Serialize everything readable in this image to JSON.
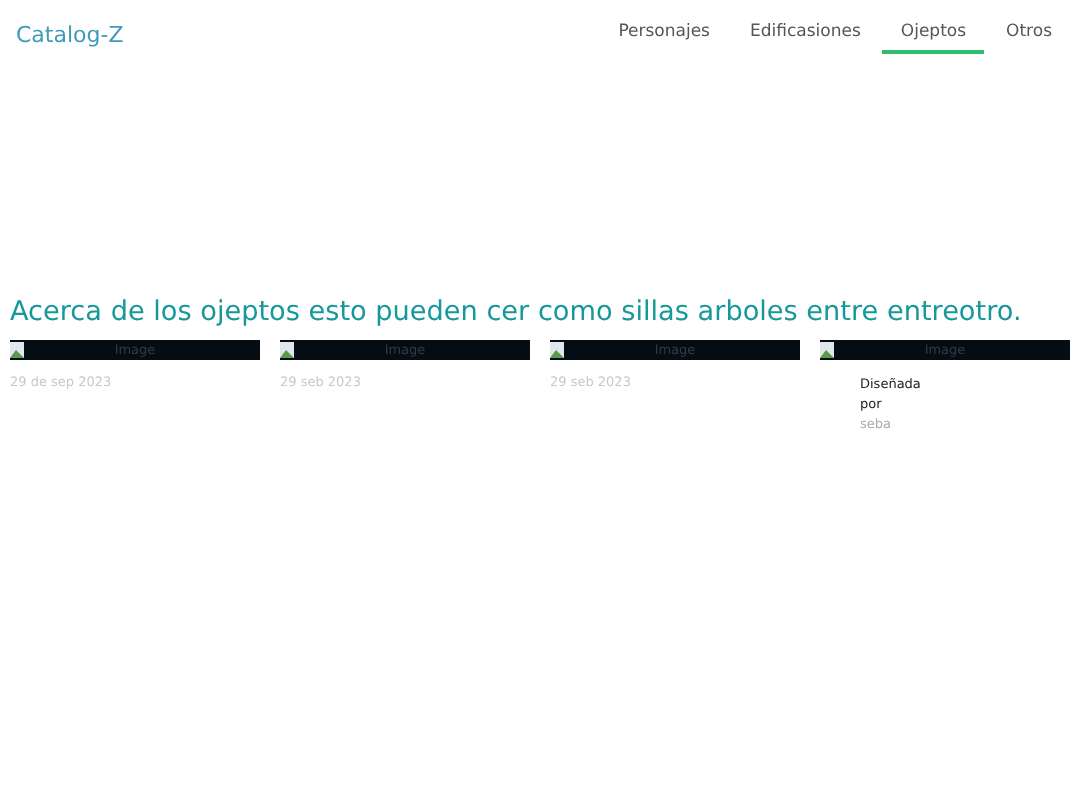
{
  "brand": "Catalog-Z",
  "nav": [
    {
      "label": "Personajes",
      "selected": false
    },
    {
      "label": "Edificasiones",
      "selected": false
    },
    {
      "label": "Ojeptos",
      "selected": true
    },
    {
      "label": "Otros",
      "selected": false
    }
  ],
  "heading": "Acerca de los ojeptos esto pueden cer como sillas arboles entre entreotro.",
  "cards": [
    {
      "image_alt": "Image",
      "kind": "date",
      "date": "29 de sep 2023"
    },
    {
      "image_alt": "Image",
      "kind": "date",
      "date": "29 seb 2023"
    },
    {
      "image_alt": "Image",
      "kind": "date",
      "date": "29 seb 2023"
    },
    {
      "image_alt": "Image",
      "kind": "credit",
      "credit_label": "Diseñada por",
      "author": "seba"
    }
  ]
}
